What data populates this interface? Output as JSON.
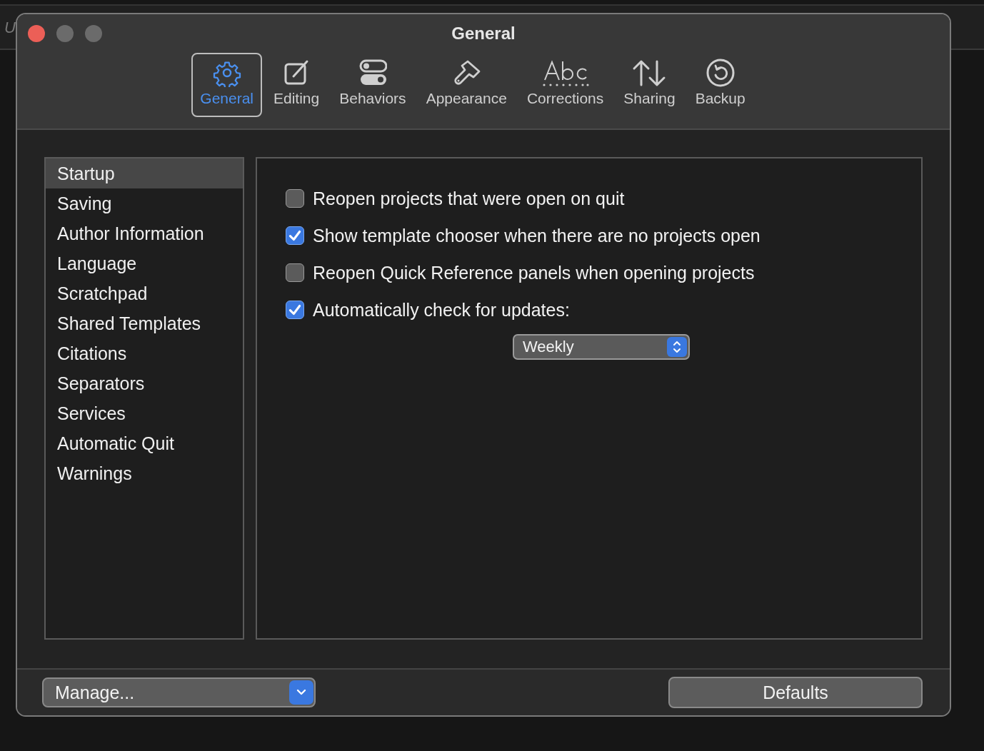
{
  "background_text": "U",
  "window": {
    "title": "General"
  },
  "toolbar": [
    {
      "label": "General",
      "selected": true
    },
    {
      "label": "Editing",
      "selected": false
    },
    {
      "label": "Behaviors",
      "selected": false
    },
    {
      "label": "Appearance",
      "selected": false
    },
    {
      "label": "Corrections",
      "selected": false
    },
    {
      "label": "Sharing",
      "selected": false
    },
    {
      "label": "Backup",
      "selected": false
    }
  ],
  "sidebar": {
    "items": [
      {
        "label": "Startup",
        "selected": true
      },
      {
        "label": "Saving",
        "selected": false
      },
      {
        "label": "Author Information",
        "selected": false
      },
      {
        "label": "Language",
        "selected": false
      },
      {
        "label": "Scratchpad",
        "selected": false
      },
      {
        "label": "Shared Templates",
        "selected": false
      },
      {
        "label": "Citations",
        "selected": false
      },
      {
        "label": "Separators",
        "selected": false
      },
      {
        "label": "Services",
        "selected": false
      },
      {
        "label": "Automatic Quit",
        "selected": false
      },
      {
        "label": "Warnings",
        "selected": false
      }
    ]
  },
  "options": [
    {
      "label": "Reopen projects that were open on quit",
      "checked": false
    },
    {
      "label": "Show template chooser when there are no projects open",
      "checked": true
    },
    {
      "label": "Reopen Quick Reference panels when opening projects",
      "checked": false
    },
    {
      "label": "Automatically check for updates:",
      "checked": true
    }
  ],
  "update_frequency": {
    "value": "Weekly"
  },
  "footer": {
    "manage": "Manage...",
    "defaults": "Defaults"
  }
}
